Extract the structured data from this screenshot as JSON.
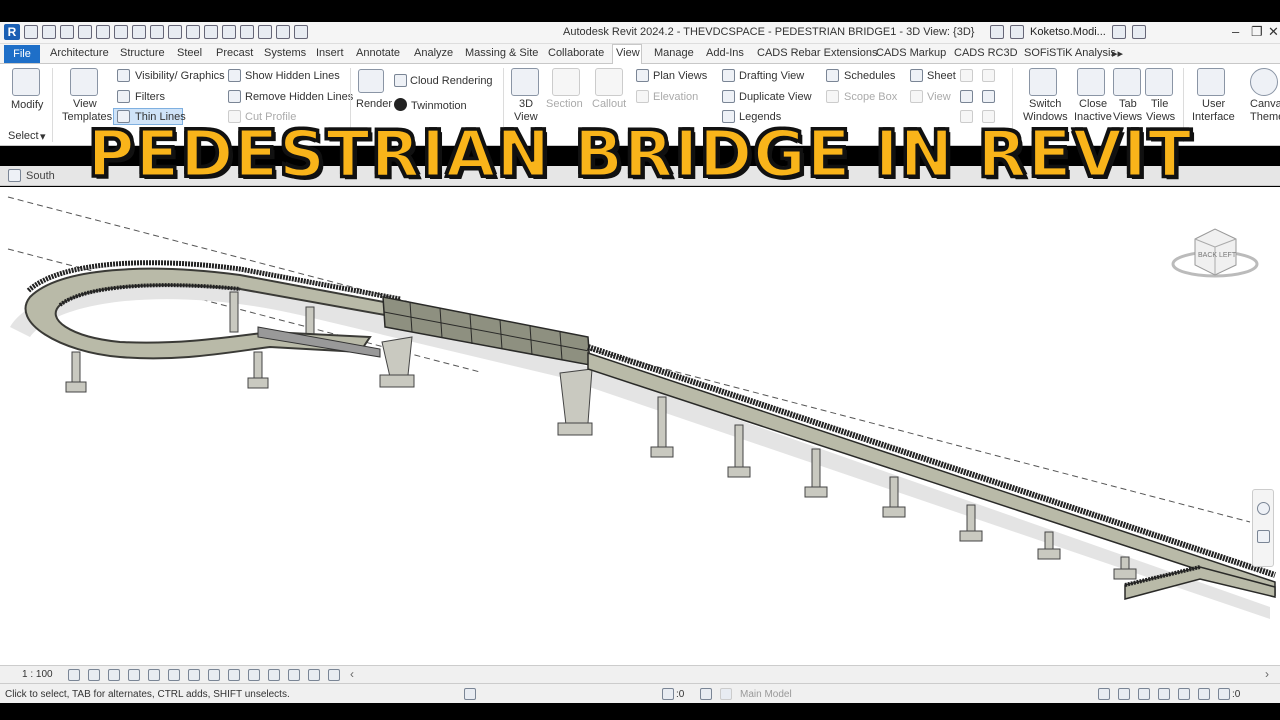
{
  "app_title": "Autodesk Revit 2024.2 - THEVDCSPACE - PEDESTRIAN BRIDGE1 - 3D View: {3D}",
  "user": "Koketso.Modi...",
  "tabs": [
    "Architecture",
    "Structure",
    "Steel",
    "Precast",
    "Systems",
    "Insert",
    "Annotate",
    "Analyze",
    "Massing & Site",
    "Collaborate",
    "View",
    "Manage",
    "Add-Ins",
    "CADS Rebar Extensions",
    "CADS Markup",
    "CADS RC3D",
    "SOFiSTiK Analysis"
  ],
  "file_tab": "File",
  "active_tab": "View",
  "ribbon": {
    "modify": "Modify",
    "select": "Select",
    "view_templates_1": "View",
    "view_templates_2": "Templates",
    "visibility_graphics": "Visibility/ Graphics",
    "filters": "Filters",
    "thin_lines": "Thin Lines",
    "show_hidden_lines": "Show Hidden Lines",
    "remove_hidden_lines": "Remove Hidden Lines",
    "cut_profile": "Cut Profile",
    "render": "Render",
    "cloud_rendering": "Cloud Rendering",
    "twinmotion": "Twinmotion",
    "view_3d_1": "3D",
    "view_3d_2": "View",
    "section": "Section",
    "callout": "Callout",
    "plan_views": "Plan Views",
    "elevation": "Elevation",
    "legends": "Legends",
    "drafting_view": "Drafting View",
    "duplicate_view": "Duplicate View",
    "schedules": "Schedules",
    "scope_box": "Scope Box",
    "sheet": "Sheet",
    "view": "View",
    "switch_windows_1": "Switch",
    "switch_windows_2": "Windows",
    "close_inactive_1": "Close",
    "close_inactive_2": "Inactive",
    "tab_views_1": "Tab",
    "tab_views_2": "Views",
    "tile_views_1": "Tile",
    "tile_views_2": "Views",
    "user_interface_1": "User",
    "user_interface_2": "Interface",
    "canvas_theme_1": "Canvas",
    "canvas_theme_2": "Theme"
  },
  "view_tabs": [
    "South"
  ],
  "overlay_title": "PEDESTRIAN BRIDGE IN REVIT",
  "viewcube": {
    "back": "BACK",
    "left": "LEFT"
  },
  "scale": "1 : 100",
  "status_text": "Click to select, TAB for alternates, CTRL adds, SHIFT unselects.",
  "model_select": "Main Model",
  "status_counts": {
    "a": ":0",
    "b": ":0"
  },
  "colors": {
    "file_tab": "#1e6fc8",
    "overlay_fill": "#f9b41a",
    "bridge_deck": "#b9baa8",
    "bridge_dark": "#3a3a36"
  }
}
